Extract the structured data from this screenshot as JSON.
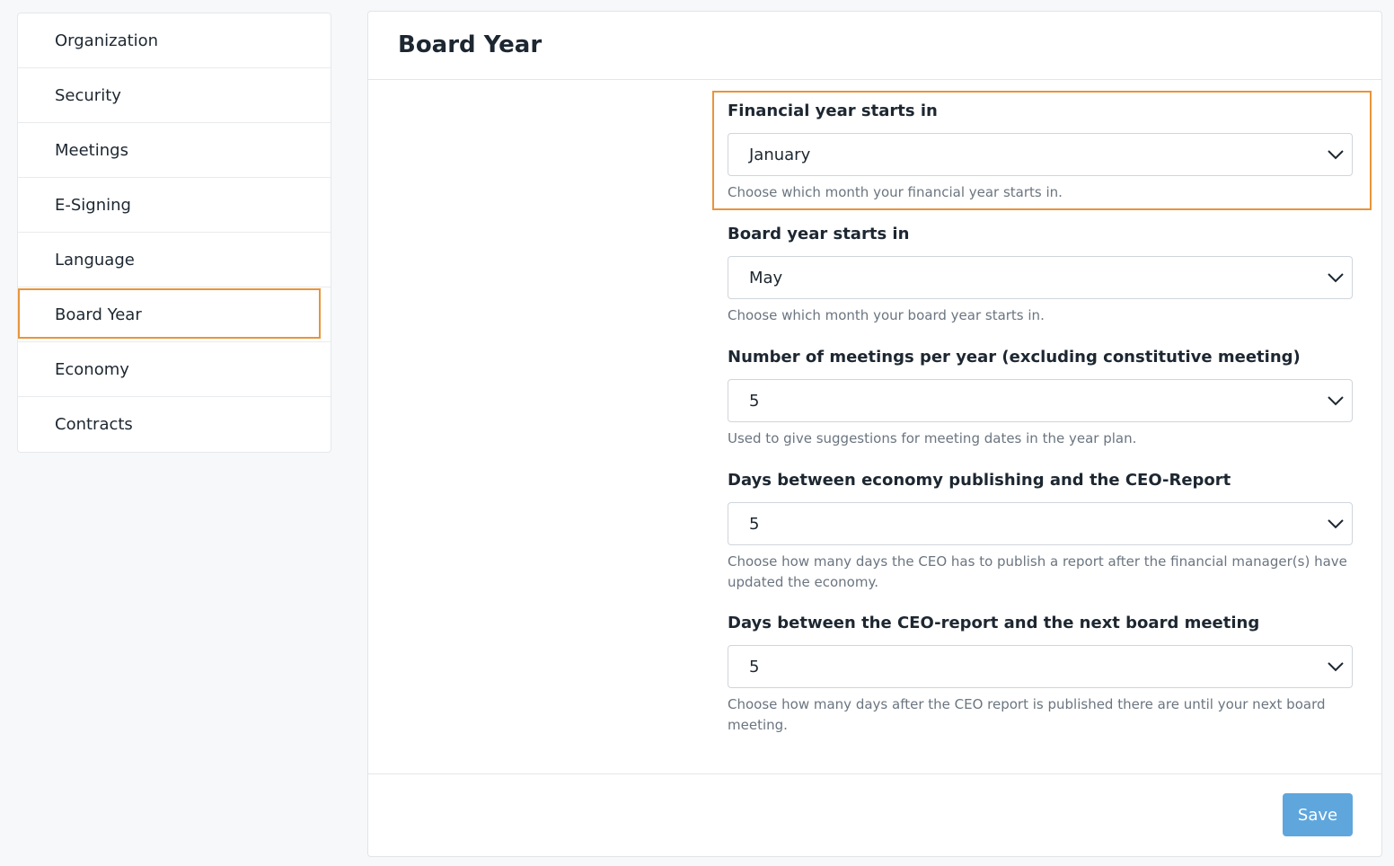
{
  "sidebar": {
    "items": [
      {
        "label": "Organization"
      },
      {
        "label": "Security"
      },
      {
        "label": "Meetings"
      },
      {
        "label": "E-Signing"
      },
      {
        "label": "Language"
      },
      {
        "label": "Board Year",
        "active": true
      },
      {
        "label": "Economy"
      },
      {
        "label": "Contracts"
      }
    ]
  },
  "page": {
    "title": "Board Year"
  },
  "form": {
    "financial_year": {
      "label": "Financial year starts in",
      "value": "January",
      "help": "Choose which month your financial year starts in."
    },
    "board_year": {
      "label": "Board year starts in",
      "value": "May",
      "help": "Choose which month your board year starts in."
    },
    "meetings_per_year": {
      "label": "Number of meetings per year (excluding constitutive meeting)",
      "value": "5",
      "help": "Used to give suggestions for meeting dates in the year plan."
    },
    "days_economy_ceo": {
      "label": "Days between economy publishing and the CEO-Report",
      "value": "5",
      "help": "Choose how many days the CEO has to publish a report after the financial manager(s) have updated the economy."
    },
    "days_ceo_meeting": {
      "label": "Days between the CEO-report and the next board meeting",
      "value": "5",
      "help": "Choose how many days after the CEO report is published there are until your next board meeting."
    }
  },
  "footer": {
    "save_label": "Save"
  },
  "colors": {
    "accent_highlight": "#e8953a",
    "save_button": "#5fa6dd",
    "background": "#f6f8fa"
  },
  "icons": {
    "select_chevron": "chevron-down-icon"
  }
}
